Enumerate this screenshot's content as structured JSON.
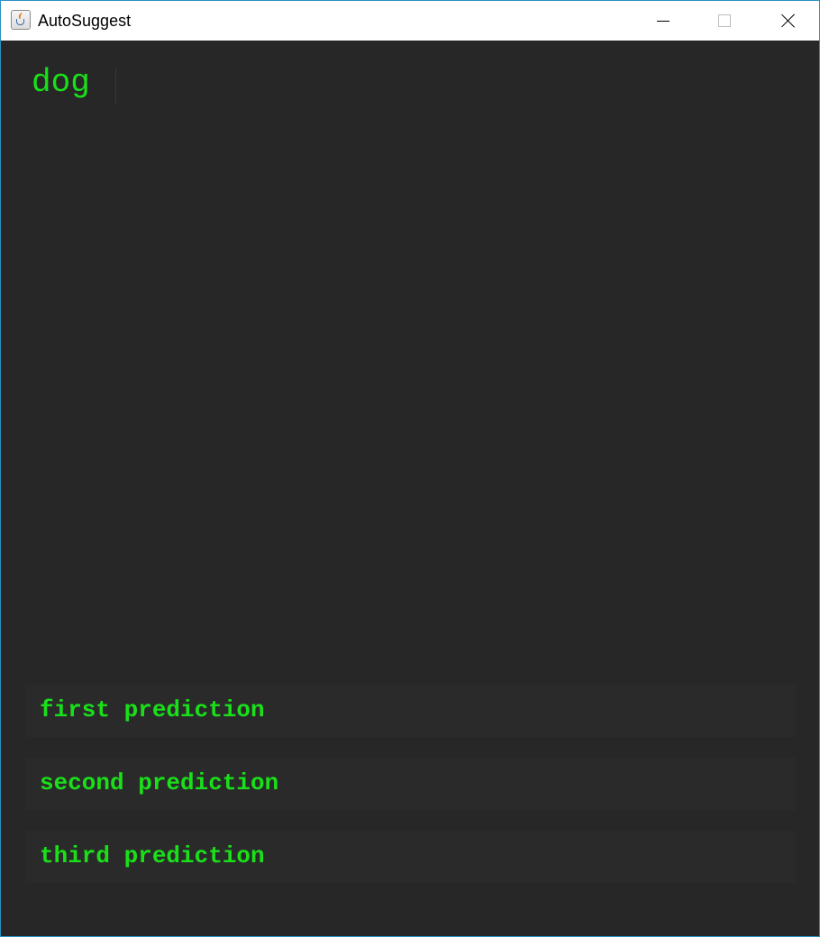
{
  "window": {
    "title": "AutoSuggest"
  },
  "icons": {
    "app": "java-cup-icon",
    "minimize": "minimize-icon",
    "maximize": "maximize-icon",
    "close": "close-icon"
  },
  "colors": {
    "background": "#282728",
    "text": "#19e019",
    "prediction_bg": "#2b2a2b"
  },
  "input": {
    "value": "dog"
  },
  "predictions": [
    {
      "label": "first prediction"
    },
    {
      "label": "second prediction"
    },
    {
      "label": "third prediction"
    }
  ]
}
